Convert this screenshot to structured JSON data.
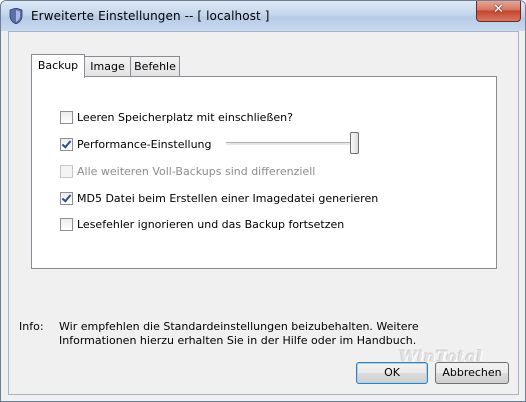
{
  "window": {
    "title": "Erweiterte Einstellungen -- [ localhost ]",
    "close_glyph": "✕",
    "app_icon": "shield-icon"
  },
  "tabs": [
    {
      "label": "Backup",
      "active": true
    },
    {
      "label": "Image",
      "active": false
    },
    {
      "label": "Befehle",
      "active": false
    }
  ],
  "options": [
    {
      "label": "Leeren Speicherplatz mit einschließen?",
      "checked": false,
      "enabled": true
    },
    {
      "label": "Performance-Einstellung",
      "checked": true,
      "enabled": true
    },
    {
      "label": "Alle weiteren Voll-Backups sind differenziell",
      "checked": false,
      "enabled": false
    },
    {
      "label": "MD5 Datei beim Erstellen einer Imagedatei generieren",
      "checked": true,
      "enabled": true
    },
    {
      "label": "Lesefehler ignorieren und das Backup fortsetzen",
      "checked": false,
      "enabled": true
    }
  ],
  "performance_slider": {
    "value_fraction": 1.0
  },
  "info": {
    "label": "Info:",
    "text": "Wir empfehlen die Standardeinstellungen beizubehalten. Weitere Informationen hierzu erhalten Sie in der Hilfe oder im Handbuch."
  },
  "watermark": "WinTotal",
  "buttons": {
    "ok": "OK",
    "cancel": "Abbrechen"
  },
  "colors": {
    "titlebar": "#c4d6ec",
    "close_button": "#c2462e",
    "panel_bg": "#f0f0f0"
  }
}
